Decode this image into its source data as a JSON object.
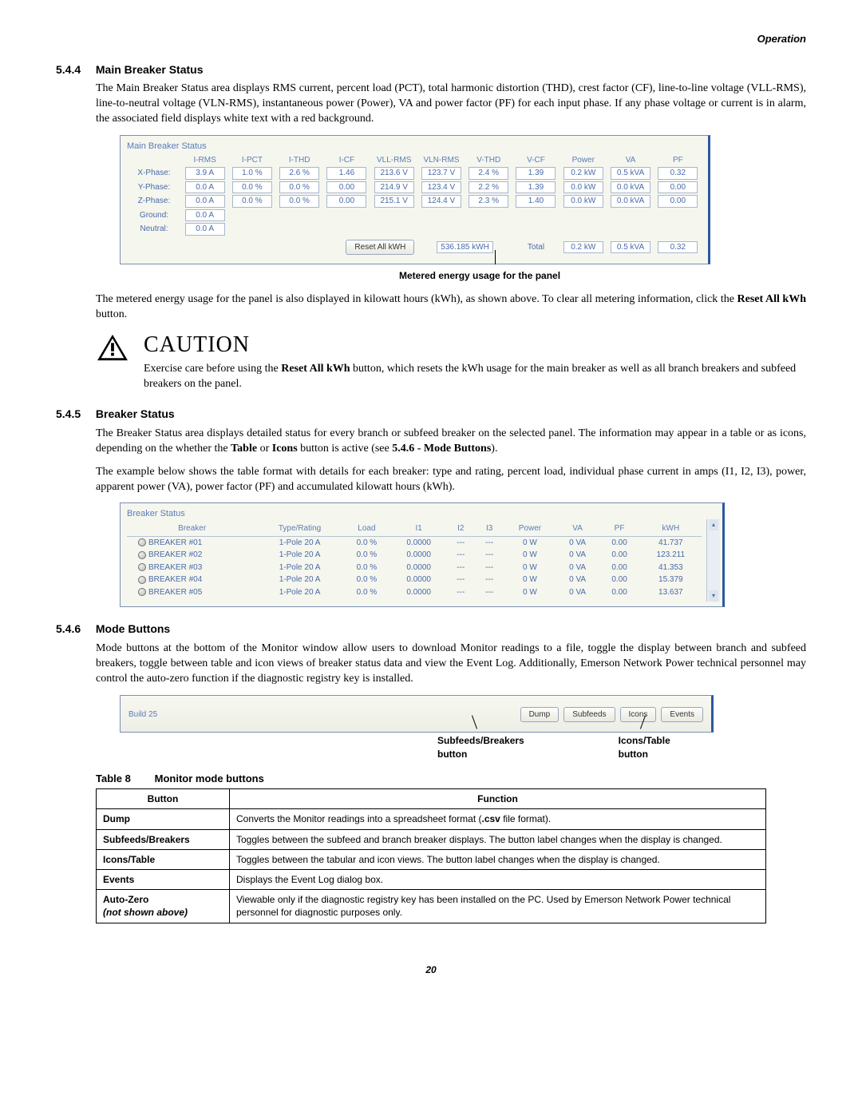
{
  "header": "Operation",
  "s544": {
    "num": "5.4.4",
    "title": "Main Breaker Status",
    "p1": "The Main Breaker Status area displays RMS current, percent load (PCT), total harmonic distortion (THD), crest factor (CF), line-to-line voltage (VLL-RMS), line-to-neutral voltage (VLN-RMS), instantaneous power (Power), VA and power factor (PF) for each input phase. If any phase voltage or current is in alarm, the associated field displays white text with a red background.",
    "p2_a": "The metered energy usage for the panel is also displayed in kilowatt hours (kWh), as shown above. To clear all metering information, click the ",
    "p2_b": "Reset All kWh",
    "p2_c": " button."
  },
  "mbs_panel": {
    "title": "Main Breaker Status",
    "cols": [
      "",
      "I-RMS",
      "I-PCT",
      "I-THD",
      "I-CF",
      "VLL-RMS",
      "VLN-RMS",
      "V-THD",
      "V-CF",
      "Power",
      "VA",
      "PF"
    ],
    "rows": [
      {
        "label": "X-Phase:",
        "v": [
          "3.9 A",
          "1.0 %",
          "2.6 %",
          "1.46",
          "213.6 V",
          "123.7 V",
          "2.4 %",
          "1.39",
          "0.2 kW",
          "0.5 kVA",
          "0.32"
        ]
      },
      {
        "label": "Y-Phase:",
        "v": [
          "0.0 A",
          "0.0 %",
          "0.0 %",
          "0.00",
          "214.9 V",
          "123.4 V",
          "2.2 %",
          "1.39",
          "0.0 kW",
          "0.0 kVA",
          "0.00"
        ]
      },
      {
        "label": "Z-Phase:",
        "v": [
          "0.0 A",
          "0.0 %",
          "0.0 %",
          "0.00",
          "215.1 V",
          "124.4 V",
          "2.3 %",
          "1.40",
          "0.0 kW",
          "0.0 kVA",
          "0.00"
        ]
      },
      {
        "label": "Ground:",
        "v": [
          "0.0 A"
        ]
      },
      {
        "label": "Neutral:",
        "v": [
          "0.0 A"
        ]
      }
    ],
    "reset_btn": "Reset All kWH",
    "kwh": "536.185 kWH",
    "total_label": "Total",
    "total": [
      "0.2 kW",
      "0.5 kVA",
      "0.32"
    ],
    "callout": "Metered energy usage for the panel"
  },
  "caution": {
    "title": "CAUTION",
    "text_a": "Exercise care before using the ",
    "text_b": "Reset All kWh",
    "text_c": " button, which resets the kWh usage for the main breaker as well as all branch breakers and subfeed breakers on the panel."
  },
  "s545": {
    "num": "5.4.5",
    "title": "Breaker Status",
    "p1_a": "The Breaker Status area displays detailed status for every branch or subfeed breaker on the selected panel. The information may appear in a table or as icons, depending on the whether the ",
    "p1_b": "Table",
    "p1_c": " or ",
    "p1_d": "Icons",
    "p1_e": " button is active (see ",
    "p1_f": "5.4.6 - Mode Buttons",
    "p1_g": ").",
    "p2": "The example below shows the table format with details for each breaker: type and rating, percent load, individual phase current in amps (I1, I2, I3), power, apparent power (VA), power factor (PF) and accumulated kilowatt hours (kWh)."
  },
  "bs_panel": {
    "title": "Breaker Status",
    "cols": [
      "Breaker",
      "Type/Rating",
      "Load",
      "I1",
      "I2",
      "I3",
      "Power",
      "VA",
      "PF",
      "kWH"
    ],
    "rows": [
      {
        "n": "BREAKER #01",
        "t": "1-Pole 20 A",
        "l": "0.0 %",
        "i1": "0.0000",
        "i2": "---",
        "i3": "---",
        "p": "0 W",
        "va": "0 VA",
        "pf": "0.00",
        "k": "41.737"
      },
      {
        "n": "BREAKER #02",
        "t": "1-Pole 20 A",
        "l": "0.0 %",
        "i1": "0.0000",
        "i2": "---",
        "i3": "---",
        "p": "0 W",
        "va": "0 VA",
        "pf": "0.00",
        "k": "123.211"
      },
      {
        "n": "BREAKER #03",
        "t": "1-Pole 20 A",
        "l": "0.0 %",
        "i1": "0.0000",
        "i2": "---",
        "i3": "---",
        "p": "0 W",
        "va": "0 VA",
        "pf": "0.00",
        "k": "41.353"
      },
      {
        "n": "BREAKER #04",
        "t": "1-Pole 20 A",
        "l": "0.0 %",
        "i1": "0.0000",
        "i2": "---",
        "i3": "---",
        "p": "0 W",
        "va": "0 VA",
        "pf": "0.00",
        "k": "15.379"
      },
      {
        "n": "BREAKER #05",
        "t": "1-Pole 20 A",
        "l": "0.0 %",
        "i1": "0.0000",
        "i2": "---",
        "i3": "---",
        "p": "0 W",
        "va": "0 VA",
        "pf": "0.00",
        "k": "13.637"
      }
    ]
  },
  "s546": {
    "num": "5.4.6",
    "title": "Mode Buttons",
    "p1": "Mode buttons at the bottom of the Monitor window allow users to download Monitor readings to a file, toggle the display between branch and subfeed breakers, toggle between table and icon views of breaker status data and view the Event Log. Additionally, Emerson Network Power technical personnel may control the auto-zero function if the diagnostic registry key is installed."
  },
  "mode_panel": {
    "build": "Build 25",
    "btns": [
      "Dump",
      "Subfeeds",
      "Icons",
      "Events"
    ],
    "label_sub": "Subfeeds/Breakers button",
    "label_icons": "Icons/Table button"
  },
  "table8": {
    "caption_a": "Table 8",
    "caption_b": "Monitor mode buttons",
    "headers": [
      "Button",
      "Function"
    ],
    "rows": [
      {
        "b": "Dump",
        "f": "Converts the Monitor readings into a spreadsheet format (<b>.csv</b> file format)."
      },
      {
        "b": "Subfeeds/Breakers",
        "f": "Toggles between the subfeed and branch breaker displays. The button label changes when the display is changed."
      },
      {
        "b": "Icons/Table",
        "f": "Toggles between the tabular and icon views. The button label changes when the display is changed."
      },
      {
        "b": "Events",
        "f": "Displays the Event Log dialog box."
      },
      {
        "b": "Auto-Zero<br><span class=\"italic\">(not shown above)</span>",
        "f": "Viewable only if the diagnostic registry key has been installed on the PC. Used by Emerson Network Power technical personnel for diagnostic purposes only."
      }
    ]
  },
  "page_num": "20"
}
